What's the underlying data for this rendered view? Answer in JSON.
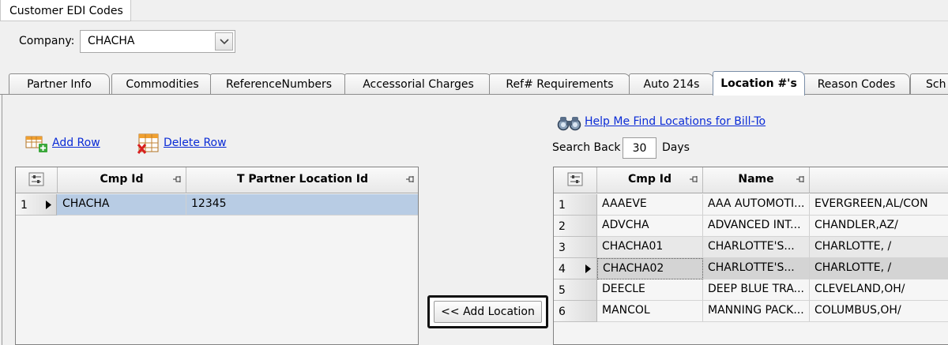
{
  "document_tab": "Customer EDI Codes",
  "company": {
    "label": "Company:",
    "value": "CHACHA"
  },
  "tabs": [
    {
      "label": "Partner Info"
    },
    {
      "label": "Commodities"
    },
    {
      "label": "ReferenceNumbers"
    },
    {
      "label": "Accessorial Charges"
    },
    {
      "label": "Ref# Requirements"
    },
    {
      "label": "Auto 214s"
    },
    {
      "label": "Location #'s",
      "active": true
    },
    {
      "label": "Reason Codes"
    },
    {
      "label": "Sch"
    }
  ],
  "left_toolbar": {
    "add_row": "Add Row",
    "delete_row": "Delete Row"
  },
  "left_grid": {
    "headers": [
      "Cmp Id",
      "T Partner Location Id"
    ],
    "rows": [
      {
        "num": "1",
        "cmp_id": "CHACHA",
        "location_id": "12345"
      }
    ]
  },
  "add_location_button": "<< Add Location",
  "right_toolbar": {
    "help_link": "Help Me Find Locations for Bill-To",
    "search_back_label": "Search Back",
    "search_back_value": "30",
    "days_label": "Days"
  },
  "right_grid": {
    "headers": [
      "Cmp Id",
      "Name",
      ""
    ],
    "rows": [
      {
        "num": "1",
        "cmp_id": "AAAEVE",
        "name": "AAA AUTOMOTI...",
        "city": "EVERGREEN,AL/CON"
      },
      {
        "num": "2",
        "cmp_id": "ADVCHA",
        "name": "ADVANCED INT...",
        "city": "CHANDLER,AZ/"
      },
      {
        "num": "3",
        "cmp_id": "CHACHA01",
        "name": "CHARLOTTE'S...",
        "city": "CHARLOTTE, /"
      },
      {
        "num": "4",
        "cmp_id": "CHACHA02",
        "name": "CHARLOTTE'S...",
        "city": "CHARLOTTE, /"
      },
      {
        "num": "5",
        "cmp_id": "DEECLE",
        "name": "DEEP BLUE TRA...",
        "city": "CLEVELAND,OH/"
      },
      {
        "num": "6",
        "cmp_id": "MANCOL",
        "name": "MANNING PACK...",
        "city": "COLUMBUS,OH/"
      }
    ]
  },
  "colors": {
    "link": "#0a2bd6",
    "selected_row": "#b8cce4",
    "current_row": "#d4d4d4"
  }
}
